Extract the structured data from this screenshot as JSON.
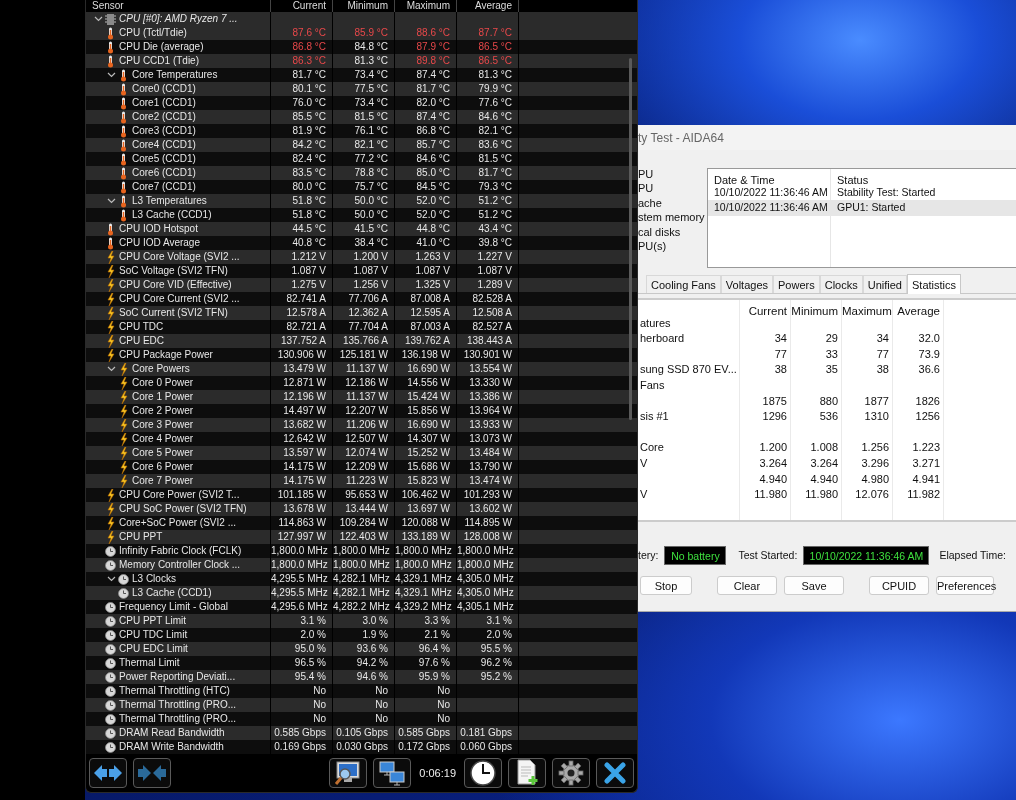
{
  "sensors": {
    "columns": [
      "Sensor",
      "Current",
      "Minimum",
      "Maximum",
      "Average"
    ],
    "tree": [
      {
        "kind": "chip",
        "name": "CPU [#0]: AMD Ryzen 7 ...",
        "expanded": true,
        "children": [
          {
            "kind": "temperature",
            "name": "CPU (Tctl/Tdie)",
            "values": [
              "87.6 °C",
              "85.9 °C",
              "88.6 °C",
              "87.7 °C"
            ],
            "alert": [
              true,
              true,
              true,
              true
            ]
          },
          {
            "kind": "temperature",
            "name": "CPU Die (average)",
            "values": [
              "86.8 °C",
              "84.8 °C",
              "87.9 °C",
              "86.5 °C"
            ],
            "alert": [
              true,
              false,
              true,
              true
            ]
          },
          {
            "kind": "temperature",
            "name": "CPU CCD1 (Tdie)",
            "values": [
              "86.3 °C",
              "81.3 °C",
              "89.8 °C",
              "86.5 °C"
            ],
            "alert": [
              true,
              false,
              true,
              true
            ]
          },
          {
            "kind": "temperature",
            "name": "Core Temperatures",
            "values": [
              "81.7 °C",
              "73.4 °C",
              "87.4 °C",
              "81.3 °C"
            ],
            "alert": [
              false,
              false,
              false,
              false
            ],
            "expanded": true,
            "children": [
              {
                "kind": "temperature",
                "name": "Core0 (CCD1)",
                "values": [
                  "80.1 °C",
                  "77.5 °C",
                  "81.7 °C",
                  "79.9 °C"
                ],
                "alert": [
                  false,
                  false,
                  false,
                  false
                ]
              },
              {
                "kind": "temperature",
                "name": "Core1 (CCD1)",
                "values": [
                  "76.0 °C",
                  "73.4 °C",
                  "82.0 °C",
                  "77.6 °C"
                ],
                "alert": [
                  false,
                  false,
                  false,
                  false
                ]
              },
              {
                "kind": "temperature",
                "name": "Core2 (CCD1)",
                "values": [
                  "85.5 °C",
                  "81.5 °C",
                  "87.4 °C",
                  "84.6 °C"
                ],
                "alert": [
                  false,
                  false,
                  false,
                  false
                ]
              },
              {
                "kind": "temperature",
                "name": "Core3 (CCD1)",
                "values": [
                  "81.9 °C",
                  "76.1 °C",
                  "86.8 °C",
                  "82.1 °C"
                ],
                "alert": [
                  false,
                  false,
                  false,
                  false
                ]
              },
              {
                "kind": "temperature",
                "name": "Core4 (CCD1)",
                "values": [
                  "84.2 °C",
                  "82.1 °C",
                  "85.7 °C",
                  "83.6 °C"
                ],
                "alert": [
                  false,
                  false,
                  false,
                  false
                ]
              },
              {
                "kind": "temperature",
                "name": "Core5 (CCD1)",
                "values": [
                  "82.4 °C",
                  "77.2 °C",
                  "84.6 °C",
                  "81.5 °C"
                ],
                "alert": [
                  false,
                  false,
                  false,
                  false
                ]
              },
              {
                "kind": "temperature",
                "name": "Core6 (CCD1)",
                "values": [
                  "83.5 °C",
                  "78.8 °C",
                  "85.0 °C",
                  "81.7 °C"
                ],
                "alert": [
                  false,
                  false,
                  false,
                  false
                ]
              },
              {
                "kind": "temperature",
                "name": "Core7 (CCD1)",
                "values": [
                  "80.0 °C",
                  "75.7 °C",
                  "84.5 °C",
                  "79.3 °C"
                ],
                "alert": [
                  false,
                  false,
                  false,
                  false
                ]
              }
            ]
          },
          {
            "kind": "temperature",
            "name": "L3 Temperatures",
            "values": [
              "51.8 °C",
              "50.0 °C",
              "52.0 °C",
              "51.2 °C"
            ],
            "alert": [
              false,
              false,
              false,
              false
            ],
            "expanded": true,
            "children": [
              {
                "kind": "temperature",
                "name": "L3 Cache (CCD1)",
                "values": [
                  "51.8 °C",
                  "50.0 °C",
                  "52.0 °C",
                  "51.2 °C"
                ],
                "alert": [
                  false,
                  false,
                  false,
                  false
                ]
              }
            ]
          },
          {
            "kind": "temperature",
            "name": "CPU IOD Hotspot",
            "values": [
              "44.5 °C",
              "41.5 °C",
              "44.8 °C",
              "43.4 °C"
            ],
            "alert": [
              false,
              false,
              false,
              false
            ]
          },
          {
            "kind": "temperature",
            "name": "CPU IOD Average",
            "values": [
              "40.8 °C",
              "38.4 °C",
              "41.0 °C",
              "39.8 °C"
            ],
            "alert": [
              false,
              false,
              false,
              false
            ]
          },
          {
            "kind": "power",
            "name": "CPU Core Voltage (SVI2 ...",
            "values": [
              "1.212 V",
              "1.200 V",
              "1.263 V",
              "1.227 V"
            ],
            "alert": [
              false,
              false,
              false,
              false
            ]
          },
          {
            "kind": "power",
            "name": "SoC Voltage (SVI2 TFN)",
            "values": [
              "1.087 V",
              "1.087 V",
              "1.087 V",
              "1.087 V"
            ],
            "alert": [
              false,
              false,
              false,
              false
            ]
          },
          {
            "kind": "power",
            "name": "CPU Core VID (Effective)",
            "values": [
              "1.275 V",
              "1.256 V",
              "1.325 V",
              "1.289 V"
            ],
            "alert": [
              false,
              false,
              false,
              false
            ]
          },
          {
            "kind": "power",
            "name": "CPU Core Current (SVI2 ...",
            "values": [
              "82.741 A",
              "77.706 A",
              "87.008 A",
              "82.528 A"
            ],
            "alert": [
              false,
              false,
              false,
              false
            ]
          },
          {
            "kind": "power",
            "name": "SoC Current (SVI2 TFN)",
            "values": [
              "12.578 A",
              "12.362 A",
              "12.595 A",
              "12.508 A"
            ],
            "alert": [
              false,
              false,
              false,
              false
            ]
          },
          {
            "kind": "power",
            "name": "CPU TDC",
            "values": [
              "82.721 A",
              "77.704 A",
              "87.003 A",
              "82.527 A"
            ],
            "alert": [
              false,
              false,
              false,
              false
            ]
          },
          {
            "kind": "power",
            "name": "CPU EDC",
            "values": [
              "137.752 A",
              "135.766 A",
              "139.762 A",
              "138.443 A"
            ],
            "alert": [
              false,
              false,
              false,
              false
            ]
          },
          {
            "kind": "power",
            "name": "CPU Package Power",
            "values": [
              "130.906 W",
              "125.181 W",
              "136.198 W",
              "130.901 W"
            ],
            "alert": [
              false,
              false,
              false,
              false
            ]
          },
          {
            "kind": "power",
            "name": "Core Powers",
            "values": [
              "13.479 W",
              "11.137 W",
              "16.690 W",
              "13.554 W"
            ],
            "alert": [
              false,
              false,
              false,
              false
            ],
            "expanded": true,
            "children": [
              {
                "kind": "power",
                "name": "Core 0 Power",
                "values": [
                  "12.871 W",
                  "12.186 W",
                  "14.556 W",
                  "13.330 W"
                ],
                "alert": [
                  false,
                  false,
                  false,
                  false
                ]
              },
              {
                "kind": "power",
                "name": "Core 1 Power",
                "values": [
                  "12.196 W",
                  "11.137 W",
                  "15.424 W",
                  "13.386 W"
                ],
                "alert": [
                  false,
                  false,
                  false,
                  false
                ]
              },
              {
                "kind": "power",
                "name": "Core 2 Power",
                "values": [
                  "14.497 W",
                  "12.207 W",
                  "15.856 W",
                  "13.964 W"
                ],
                "alert": [
                  false,
                  false,
                  false,
                  false
                ]
              },
              {
                "kind": "power",
                "name": "Core 3 Power",
                "values": [
                  "13.682 W",
                  "11.206 W",
                  "16.690 W",
                  "13.933 W"
                ],
                "alert": [
                  false,
                  false,
                  false,
                  false
                ]
              },
              {
                "kind": "power",
                "name": "Core 4 Power",
                "values": [
                  "12.642 W",
                  "12.507 W",
                  "14.307 W",
                  "13.073 W"
                ],
                "alert": [
                  false,
                  false,
                  false,
                  false
                ]
              },
              {
                "kind": "power",
                "name": "Core 5 Power",
                "values": [
                  "13.597 W",
                  "12.074 W",
                  "15.252 W",
                  "13.484 W"
                ],
                "alert": [
                  false,
                  false,
                  false,
                  false
                ]
              },
              {
                "kind": "power",
                "name": "Core 6 Power",
                "values": [
                  "14.175 W",
                  "12.209 W",
                  "15.686 W",
                  "13.790 W"
                ],
                "alert": [
                  false,
                  false,
                  false,
                  false
                ]
              },
              {
                "kind": "power",
                "name": "Core 7 Power",
                "values": [
                  "14.175 W",
                  "11.223 W",
                  "15.823 W",
                  "13.474 W"
                ],
                "alert": [
                  false,
                  false,
                  false,
                  false
                ]
              }
            ]
          },
          {
            "kind": "power",
            "name": "CPU Core Power (SVI2 T...",
            "values": [
              "101.185 W",
              "95.653 W",
              "106.462 W",
              "101.293 W"
            ],
            "alert": [
              false,
              false,
              false,
              false
            ]
          },
          {
            "kind": "power",
            "name": "CPU SoC Power (SVI2 TFN)",
            "values": [
              "13.678 W",
              "13.444 W",
              "13.697 W",
              "13.602 W"
            ],
            "alert": [
              false,
              false,
              false,
              false
            ]
          },
          {
            "kind": "power",
            "name": "Core+SoC Power (SVI2 ...",
            "values": [
              "114.863 W",
              "109.284 W",
              "120.088 W",
              "114.895 W"
            ],
            "alert": [
              false,
              false,
              false,
              false
            ]
          },
          {
            "kind": "power",
            "name": "CPU PPT",
            "values": [
              "127.997 W",
              "122.403 W",
              "133.189 W",
              "128.008 W"
            ],
            "alert": [
              false,
              false,
              false,
              false
            ]
          },
          {
            "kind": "clock",
            "name": "Infinity Fabric Clock (FCLK)",
            "values": [
              "1,800.0 MHz",
              "1,800.0 MHz",
              "1,800.0 MHz",
              "1,800.0 MHz"
            ],
            "alert": [
              false,
              false,
              false,
              false
            ]
          },
          {
            "kind": "clock",
            "name": "Memory Controller Clock ...",
            "values": [
              "1,800.0 MHz",
              "1,800.0 MHz",
              "1,800.0 MHz",
              "1,800.0 MHz"
            ],
            "alert": [
              false,
              false,
              false,
              false
            ]
          },
          {
            "kind": "clock",
            "name": "L3 Clocks",
            "values": [
              "4,295.5 MHz",
              "4,282.1 MHz",
              "4,329.1 MHz",
              "4,305.0 MHz"
            ],
            "alert": [
              false,
              false,
              false,
              false
            ],
            "expanded": true,
            "children": [
              {
                "kind": "clock",
                "name": "L3 Cache (CCD1)",
                "values": [
                  "4,295.5 MHz",
                  "4,282.1 MHz",
                  "4,329.1 MHz",
                  "4,305.0 MHz"
                ],
                "alert": [
                  false,
                  false,
                  false,
                  false
                ]
              }
            ]
          },
          {
            "kind": "clock",
            "name": "Frequency Limit - Global",
            "values": [
              "4,295.6 MHz",
              "4,282.2 MHz",
              "4,329.2 MHz",
              "4,305.1 MHz"
            ],
            "alert": [
              false,
              false,
              false,
              false
            ]
          },
          {
            "kind": "clock",
            "name": "CPU PPT Limit",
            "values": [
              "3.1 %",
              "3.0 %",
              "3.3 %",
              "3.1 %"
            ],
            "alert": [
              false,
              false,
              false,
              false
            ]
          },
          {
            "kind": "clock",
            "name": "CPU TDC Limit",
            "values": [
              "2.0 %",
              "1.9 %",
              "2.1 %",
              "2.0 %"
            ],
            "alert": [
              false,
              false,
              false,
              false
            ]
          },
          {
            "kind": "clock",
            "name": "CPU EDC Limit",
            "values": [
              "95.0 %",
              "93.6 %",
              "96.4 %",
              "95.5 %"
            ],
            "alert": [
              false,
              false,
              false,
              false
            ]
          },
          {
            "kind": "clock",
            "name": "Thermal Limit",
            "values": [
              "96.5 %",
              "94.2 %",
              "97.6 %",
              "96.2 %"
            ],
            "alert": [
              false,
              false,
              false,
              false
            ]
          },
          {
            "kind": "clock",
            "name": "Power Reporting Deviati...",
            "values": [
              "95.4 %",
              "94.6 %",
              "95.9 %",
              "95.2 %"
            ],
            "alert": [
              false,
              false,
              false,
              false
            ]
          },
          {
            "kind": "clock",
            "name": "Thermal Throttling (HTC)",
            "values": [
              "No",
              "No",
              "No"
            ],
            "alert": [
              false,
              false,
              false
            ]
          },
          {
            "kind": "clock",
            "name": "Thermal Throttling (PRO...",
            "values": [
              "No",
              "No",
              "No"
            ],
            "alert": [
              false,
              false,
              false
            ]
          },
          {
            "kind": "clock",
            "name": "Thermal Throttling (PRO...",
            "values": [
              "No",
              "No",
              "No"
            ],
            "alert": [
              false,
              false,
              false
            ]
          },
          {
            "kind": "clock",
            "name": "DRAM Read Bandwidth",
            "values": [
              "0.585 Gbps",
              "0.105 Gbps",
              "0.585 Gbps",
              "0.181 Gbps"
            ],
            "alert": [
              false,
              false,
              false,
              false
            ]
          },
          {
            "kind": "clock",
            "name": "DRAM Write Bandwidth",
            "values": [
              "0.169 Gbps",
              "0.030 Gbps",
              "0.172 Gbps",
              "0.060 Gbps"
            ],
            "alert": [
              false,
              false,
              false,
              false
            ]
          }
        ]
      }
    ],
    "toolbar": {
      "time": "0:06:19"
    }
  },
  "stability_test": {
    "title": "ty Test - AIDA64",
    "checks": [
      "PU",
      "PU",
      "ache",
      "stem memory",
      "cal disks",
      "PU(s)"
    ],
    "log": {
      "columns": [
        "Date & Time",
        "Status"
      ],
      "rows": [
        {
          "cells": [
            "10/10/2022 11:36:46 AM",
            "Stability Test: Started"
          ],
          "selected": false
        },
        {
          "cells": [
            "10/10/2022 11:36:46 AM",
            "GPU1: Started"
          ],
          "selected": true
        }
      ]
    },
    "tabs": [
      {
        "label": "Cooling Fans",
        "selected": false
      },
      {
        "label": "Voltages",
        "selected": false
      },
      {
        "label": "Powers",
        "selected": false
      },
      {
        "label": "Clocks",
        "selected": false
      },
      {
        "label": "Unified",
        "selected": false
      },
      {
        "label": "Statistics",
        "selected": true
      }
    ],
    "statistics": {
      "columns": [
        "Current",
        "Minimum",
        "Maximum",
        "Average"
      ],
      "rows": [
        {
          "kind": "group",
          "label": "atures"
        },
        {
          "kind": "data",
          "label": "herboard",
          "values": [
            "34",
            "29",
            "34",
            "32.0"
          ]
        },
        {
          "kind": "data",
          "values": [
            "77",
            "33",
            "77",
            "73.9"
          ]
        },
        {
          "kind": "data",
          "label": "sung SSD 870 EV...",
          "values": [
            "38",
            "35",
            "38",
            "36.6"
          ]
        },
        {
          "kind": "group",
          "label": "Fans"
        },
        {
          "kind": "data",
          "values": [
            "1875",
            "880",
            "1877",
            "1826"
          ]
        },
        {
          "kind": "data",
          "label": "sis #1",
          "values": [
            "1296",
            "536",
            "1310",
            "1256"
          ]
        },
        {
          "kind": "group"
        },
        {
          "kind": "data",
          "label": "Core",
          "values": [
            "1.200",
            "1.008",
            "1.256",
            "1.223"
          ]
        },
        {
          "kind": "data",
          "label": "V",
          "values": [
            "3.264",
            "3.264",
            "3.296",
            "3.271"
          ]
        },
        {
          "kind": "data",
          "values": [
            "4.940",
            "4.940",
            "4.980",
            "4.941"
          ]
        },
        {
          "kind": "data",
          "label": "V",
          "values": [
            "11.980",
            "11.980",
            "12.076",
            "11.982"
          ]
        }
      ]
    },
    "status": {
      "battery_label": "tery:",
      "battery": "No battery",
      "started_label": "Test Started:",
      "started": "10/10/2022 11:36:46 AM",
      "elapsed_label": "Elapsed Time:"
    },
    "buttons": [
      "Stop",
      "Clear",
      "Save",
      "CPUID",
      "Preferences"
    ]
  }
}
